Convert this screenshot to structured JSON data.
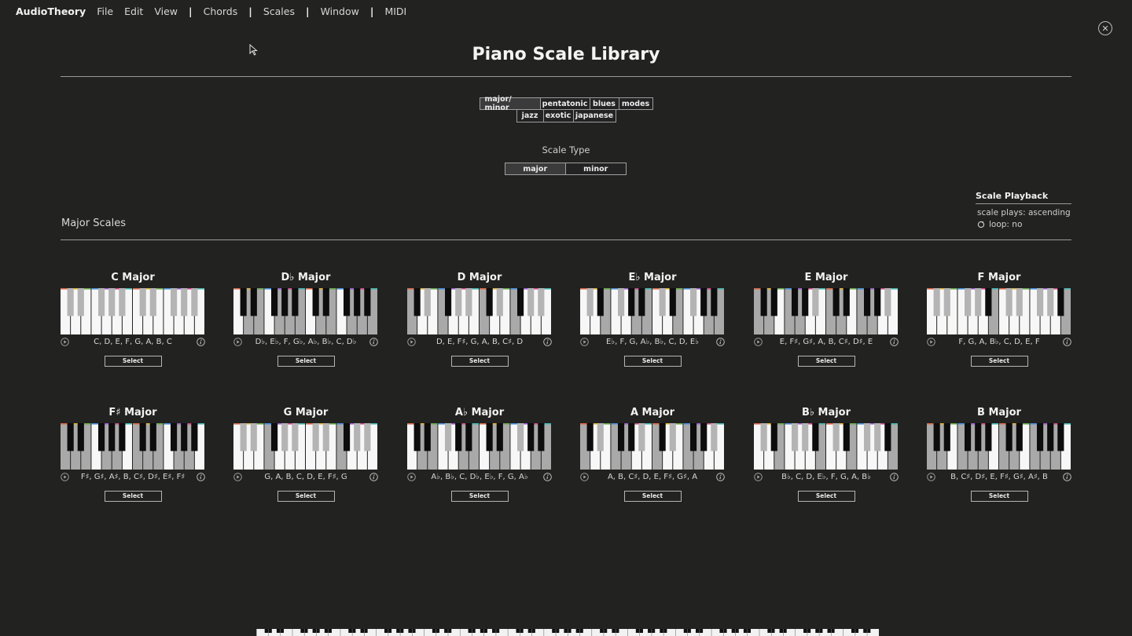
{
  "menu": {
    "brand": "AudioTheory",
    "items": [
      "File",
      "Edit",
      "View",
      "Chords",
      "Scales",
      "Window",
      "MIDI"
    ]
  },
  "page": {
    "title": "Piano Scale Library",
    "categories_row1": [
      "major/ minor",
      "pentatonic",
      "blues",
      "modes"
    ],
    "categories_row2": [
      "jazz",
      "exotic",
      "japanese"
    ],
    "active_category": "major/ minor",
    "scale_type_label": "Scale Type",
    "scale_types": [
      "major",
      "minor"
    ],
    "active_scale_type": "major",
    "section_title": "Major Scales"
  },
  "playback": {
    "title": "Scale Playback",
    "plays": "scale plays: ascending",
    "loop": "loop: no"
  },
  "select_label": "Select",
  "scales": [
    {
      "name": "C Major",
      "notes": "C, D, E, F, G, A, B, C",
      "pattern": [
        1,
        0,
        1,
        0,
        1,
        1,
        0,
        1,
        0,
        1,
        0,
        1,
        1,
        0,
        1,
        0,
        1,
        1,
        0,
        1,
        0,
        1,
        0,
        1
      ]
    },
    {
      "name": "D♭ Major",
      "notes": "D♭, E♭, F, G♭, A♭, B♭, C, D♭",
      "pattern": [
        1,
        1,
        0,
        1,
        0,
        1,
        1,
        0,
        1,
        0,
        1,
        0,
        1,
        1,
        0,
        1,
        0,
        1,
        1,
        0,
        1,
        0,
        1,
        0
      ]
    },
    {
      "name": "D Major",
      "notes": "D, E, F♯, G, A, B, C♯, D",
      "pattern": [
        0,
        1,
        1,
        0,
        1,
        0,
        1,
        1,
        0,
        1,
        0,
        1,
        0,
        1,
        1,
        0,
        1,
        0,
        1,
        1,
        0,
        1,
        0,
        1
      ]
    },
    {
      "name": "E♭ Major",
      "notes": "E♭, F, G, A♭, B♭, C, D, E♭",
      "pattern": [
        1,
        0,
        1,
        1,
        0,
        1,
        0,
        1,
        1,
        0,
        1,
        0,
        1,
        0,
        1,
        1,
        0,
        1,
        0,
        1,
        1,
        0,
        1,
        0
      ]
    },
    {
      "name": "E Major",
      "notes": "E, F♯, G♯, A, B, C♯, D♯, E",
      "pattern": [
        0,
        1,
        0,
        1,
        1,
        0,
        1,
        0,
        1,
        1,
        0,
        1,
        0,
        1,
        0,
        1,
        1,
        0,
        1,
        0,
        1,
        1,
        0,
        1
      ]
    },
    {
      "name": "F Major",
      "notes": "F, G, A, B♭, C, D, E, F",
      "pattern": [
        1,
        0,
        1,
        0,
        1,
        1,
        0,
        1,
        0,
        1,
        1,
        0,
        1,
        0,
        1,
        0,
        1,
        1,
        0,
        1,
        0,
        1,
        1,
        0
      ]
    },
    {
      "name": "F♯ Major",
      "notes": "F♯, G♯, A♯, B, C♯, D♯, E♯, F♯",
      "pattern": [
        0,
        1,
        0,
        1,
        0,
        1,
        1,
        0,
        1,
        0,
        1,
        1,
        0,
        1,
        0,
        1,
        0,
        1,
        1,
        0,
        1,
        0,
        1,
        1
      ]
    },
    {
      "name": "G Major",
      "notes": "G, A, B, C, D, E, F♯, G",
      "pattern": [
        1,
        0,
        1,
        0,
        1,
        0,
        1,
        1,
        0,
        1,
        0,
        1,
        1,
        0,
        1,
        0,
        1,
        0,
        1,
        1,
        0,
        1,
        0,
        1
      ]
    },
    {
      "name": "A♭ Major",
      "notes": "A♭, B♭, C, D♭, E♭, F, G, A♭",
      "pattern": [
        1,
        1,
        0,
        1,
        0,
        1,
        0,
        1,
        1,
        0,
        1,
        0,
        1,
        1,
        0,
        1,
        0,
        1,
        0,
        1,
        1,
        0,
        1,
        0
      ]
    },
    {
      "name": "A Major",
      "notes": "A, B, C♯, D, E, F♯, G♯, A",
      "pattern": [
        0,
        1,
        1,
        0,
        1,
        0,
        1,
        0,
        1,
        1,
        0,
        1,
        0,
        1,
        1,
        0,
        1,
        0,
        1,
        0,
        1,
        1,
        0,
        1
      ]
    },
    {
      "name": "B♭ Major",
      "notes": "B♭, C, D, E♭, F, G, A, B♭",
      "pattern": [
        1,
        0,
        1,
        1,
        0,
        1,
        0,
        1,
        0,
        1,
        1,
        0,
        1,
        0,
        1,
        1,
        0,
        1,
        0,
        1,
        0,
        1,
        1,
        0
      ]
    },
    {
      "name": "B Major",
      "notes": "B, C♯, D♯, E, F♯, G♯, A♯, B",
      "pattern": [
        0,
        1,
        0,
        1,
        1,
        0,
        1,
        0,
        1,
        0,
        1,
        1,
        0,
        1,
        0,
        1,
        1,
        0,
        1,
        0,
        1,
        0,
        1,
        1
      ]
    }
  ]
}
